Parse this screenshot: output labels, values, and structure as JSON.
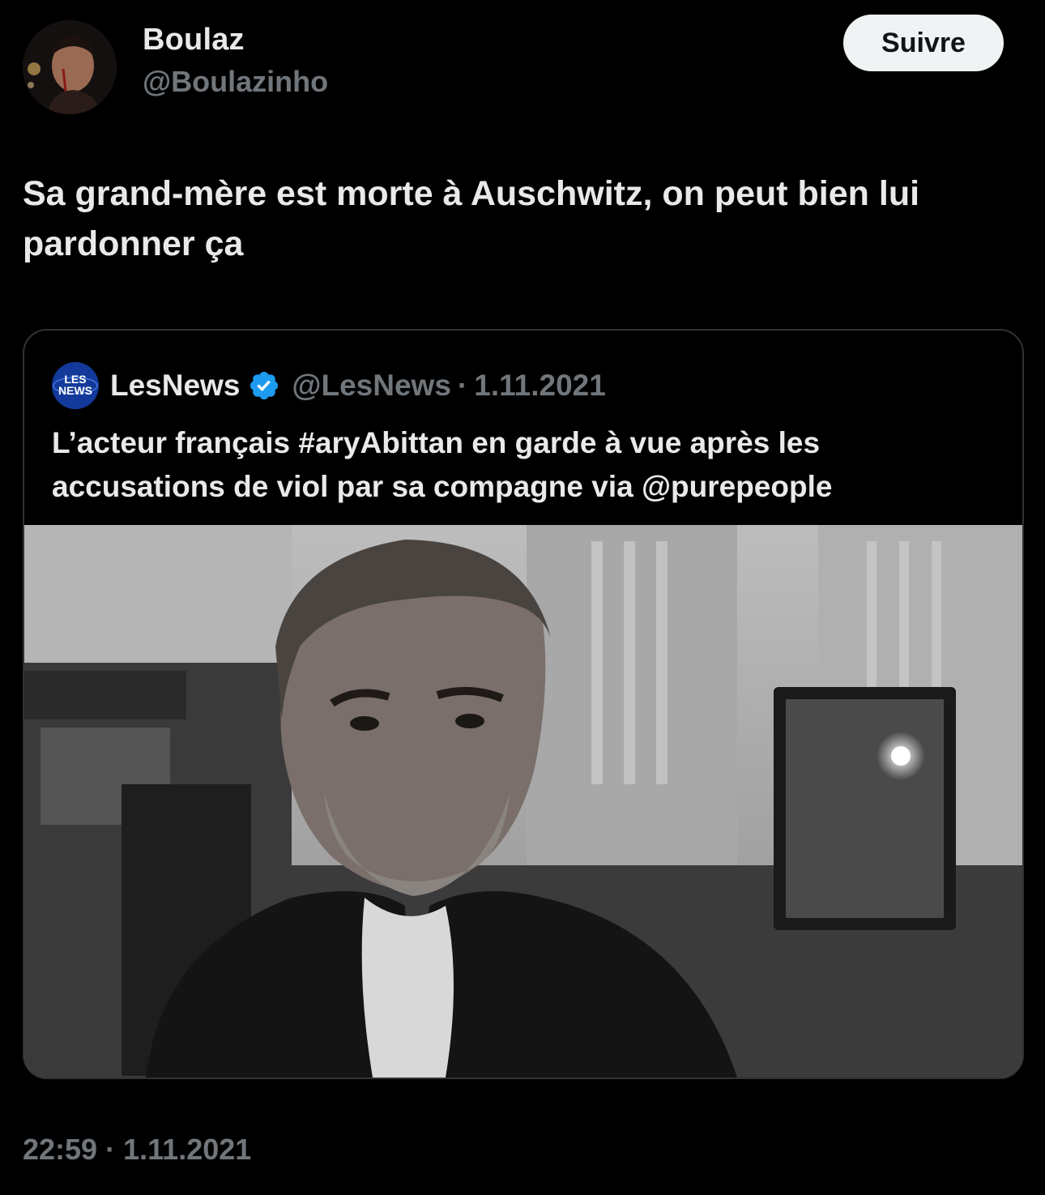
{
  "post": {
    "author": {
      "display_name": "Boulaz",
      "username": "@Boulazinho",
      "avatar_icon": "profile-photo"
    },
    "follow_label": "Suivre",
    "text": "Sa grand-mère est morte à Auschwitz, on peut bien lui pardonner ça",
    "time": "22:59",
    "date": "1.11.2021",
    "separator": "·"
  },
  "quoted": {
    "display_name": "LesNews",
    "username": "@LesNews",
    "separator": "·",
    "date": "1.11.2021",
    "verified": true,
    "text": "L’acteur français #aryAbittan en garde à vue après les accusations de viol par sa compagne via  @purepeople",
    "media_alt_icon": "photo",
    "logo": {
      "line1": "LES",
      "line2": "NEWS"
    }
  },
  "colors": {
    "background": "#000000",
    "text_primary": "#e7e9ea",
    "text_secondary": "#71767b",
    "border": "#2f3336",
    "follow_bg": "#eff3f4",
    "verified": "#1d9bf0"
  }
}
